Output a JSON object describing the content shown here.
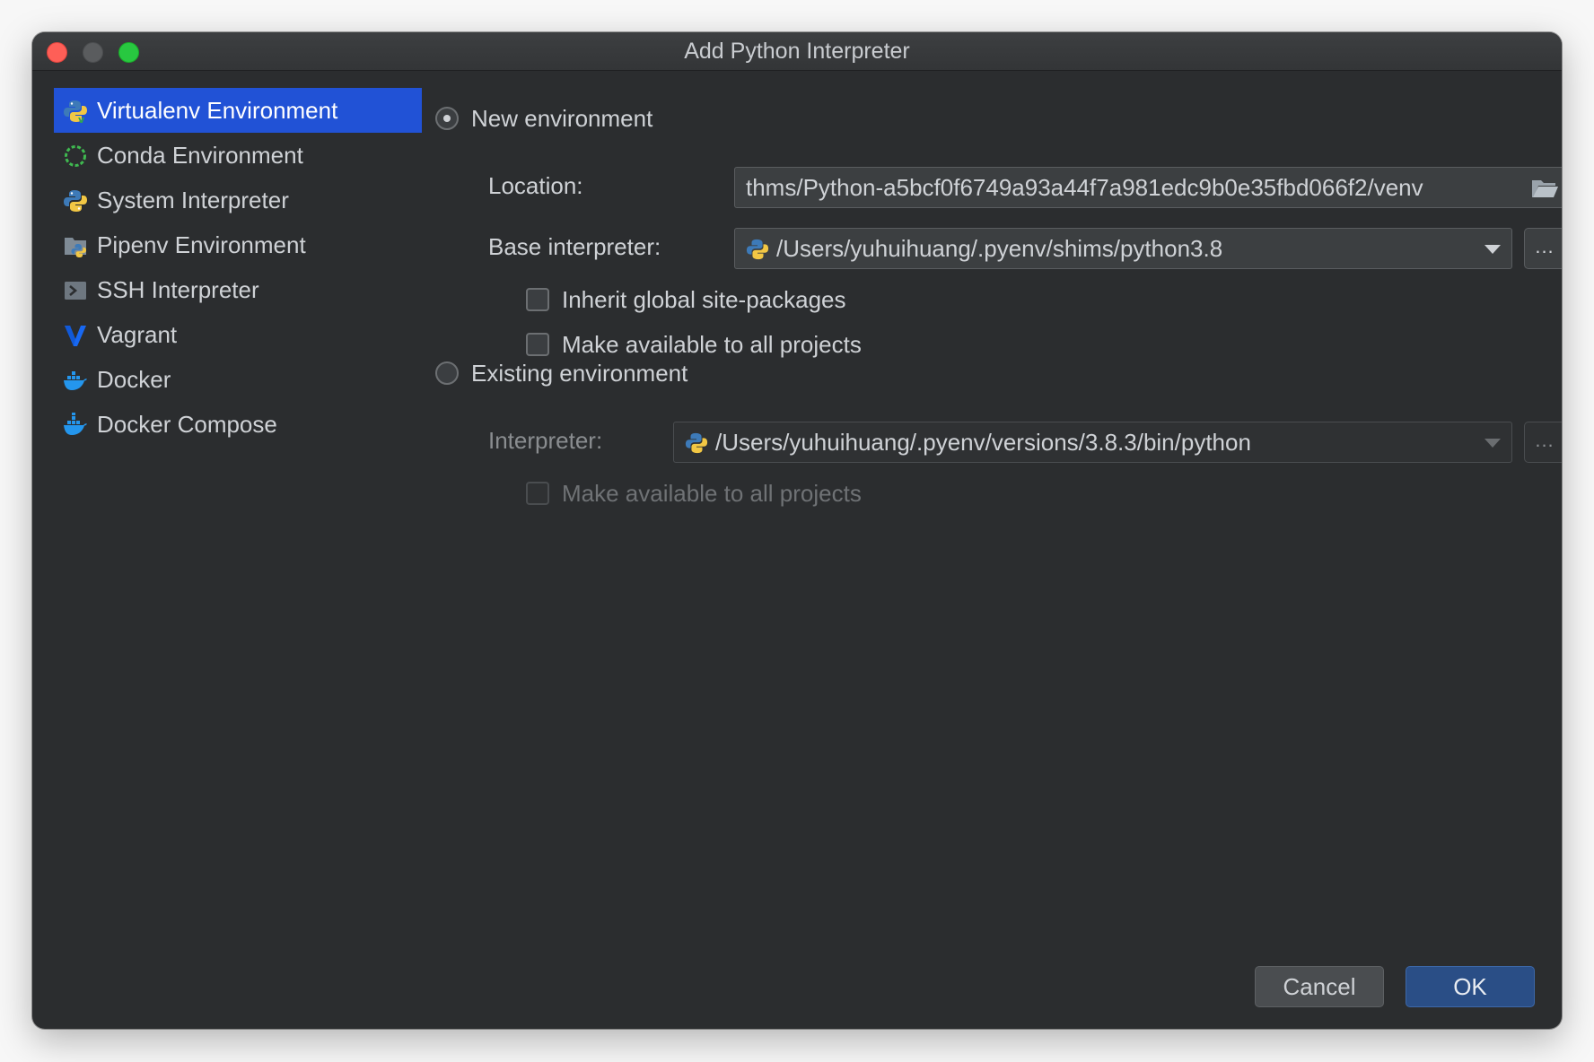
{
  "window": {
    "title": "Add Python Interpreter"
  },
  "sidebar": {
    "items": [
      {
        "label": "Virtualenv Environment",
        "icon": "virtualenv-icon",
        "selected": true
      },
      {
        "label": "Conda Environment",
        "icon": "conda-icon",
        "selected": false
      },
      {
        "label": "System Interpreter",
        "icon": "python-icon",
        "selected": false
      },
      {
        "label": "Pipenv Environment",
        "icon": "pipenv-icon",
        "selected": false
      },
      {
        "label": "SSH Interpreter",
        "icon": "ssh-terminal-icon",
        "selected": false
      },
      {
        "label": "Vagrant",
        "icon": "vagrant-icon",
        "selected": false
      },
      {
        "label": "Docker",
        "icon": "docker-icon",
        "selected": false
      },
      {
        "label": "Docker Compose",
        "icon": "docker-compose-icon",
        "selected": false
      }
    ]
  },
  "new_env": {
    "radio_label": "New environment",
    "selected": true,
    "location_label": "Location:",
    "location_value": "thms/Python-a5bcf0f6749a93a44f7a981edc9b0e35fbd066f2/venv",
    "base_label": "Base interpreter:",
    "base_value": "/Users/yuhuihuang/.pyenv/shims/python3.8",
    "browse_label": "...",
    "inherit_label": "Inherit global site-packages",
    "inherit_checked": false,
    "make_available_label": "Make available to all projects",
    "make_available_checked": false
  },
  "existing_env": {
    "radio_label": "Existing environment",
    "selected": false,
    "interpreter_label": "Interpreter:",
    "interpreter_value": "/Users/yuhuihuang/.pyenv/versions/3.8.3/bin/python",
    "browse_label": "...",
    "make_available_label": "Make available to all projects",
    "make_available_checked": false
  },
  "footer": {
    "cancel_label": "Cancel",
    "ok_label": "OK"
  },
  "colors": {
    "selection": "#2152d6",
    "ok_button": "#2a4e86",
    "window_bg": "#2b2d2f",
    "python_blue": "#3d7ab8",
    "python_yellow": "#f2c744"
  }
}
